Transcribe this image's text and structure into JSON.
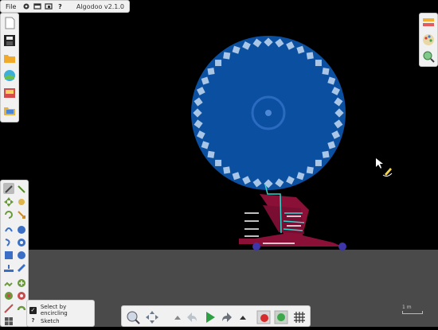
{
  "app": {
    "title": "Algodoo v2.1.0"
  },
  "menubar": {
    "file_label": "File",
    "icons": [
      "gear-icon",
      "window-icon",
      "window-icon",
      "help-icon"
    ],
    "help_label": "?"
  },
  "left_toolbar": {
    "items": [
      "new-scene-icon",
      "save-icon",
      "open-folder-icon",
      "browse-scenes-icon",
      "algobox-icon",
      "folder-icon"
    ]
  },
  "right_toolbar": {
    "items": [
      "layers-icon",
      "palette-icon",
      "zoom-settings-icon"
    ]
  },
  "tool_palette": {
    "items": [
      "select",
      "sketch",
      "move",
      "drag",
      "rotate",
      "scale",
      "cut",
      "gear",
      "rope",
      "spring",
      "hinge",
      "fixate",
      "brush",
      "circle",
      "box",
      "plane",
      "chain",
      "thruster",
      "tracer",
      "laser",
      "knife",
      "polygon",
      "texture",
      "grid"
    ]
  },
  "selection_options": {
    "select_by_encircling_label": "Select by encircling",
    "sketch_label": "Sketch",
    "help_glyph": "?"
  },
  "bottom_toolbar": {
    "items": [
      "zoom-icon",
      "pan-icon",
      "collapse-up-icon",
      "undo-icon",
      "play-icon",
      "redo-icon",
      "expand-up-icon",
      "record-icon",
      "follow-icon",
      "grid-icon"
    ]
  },
  "scale_bar": {
    "label": "1 m"
  },
  "colors": {
    "background": "#000000",
    "ground": "#4a4a4a",
    "wheel": "#0b4fa0",
    "wheel_dots": "#a9c6e6",
    "frame": "#8b1038",
    "axle": "#3d35a8",
    "panel": "#f1f1f1"
  }
}
